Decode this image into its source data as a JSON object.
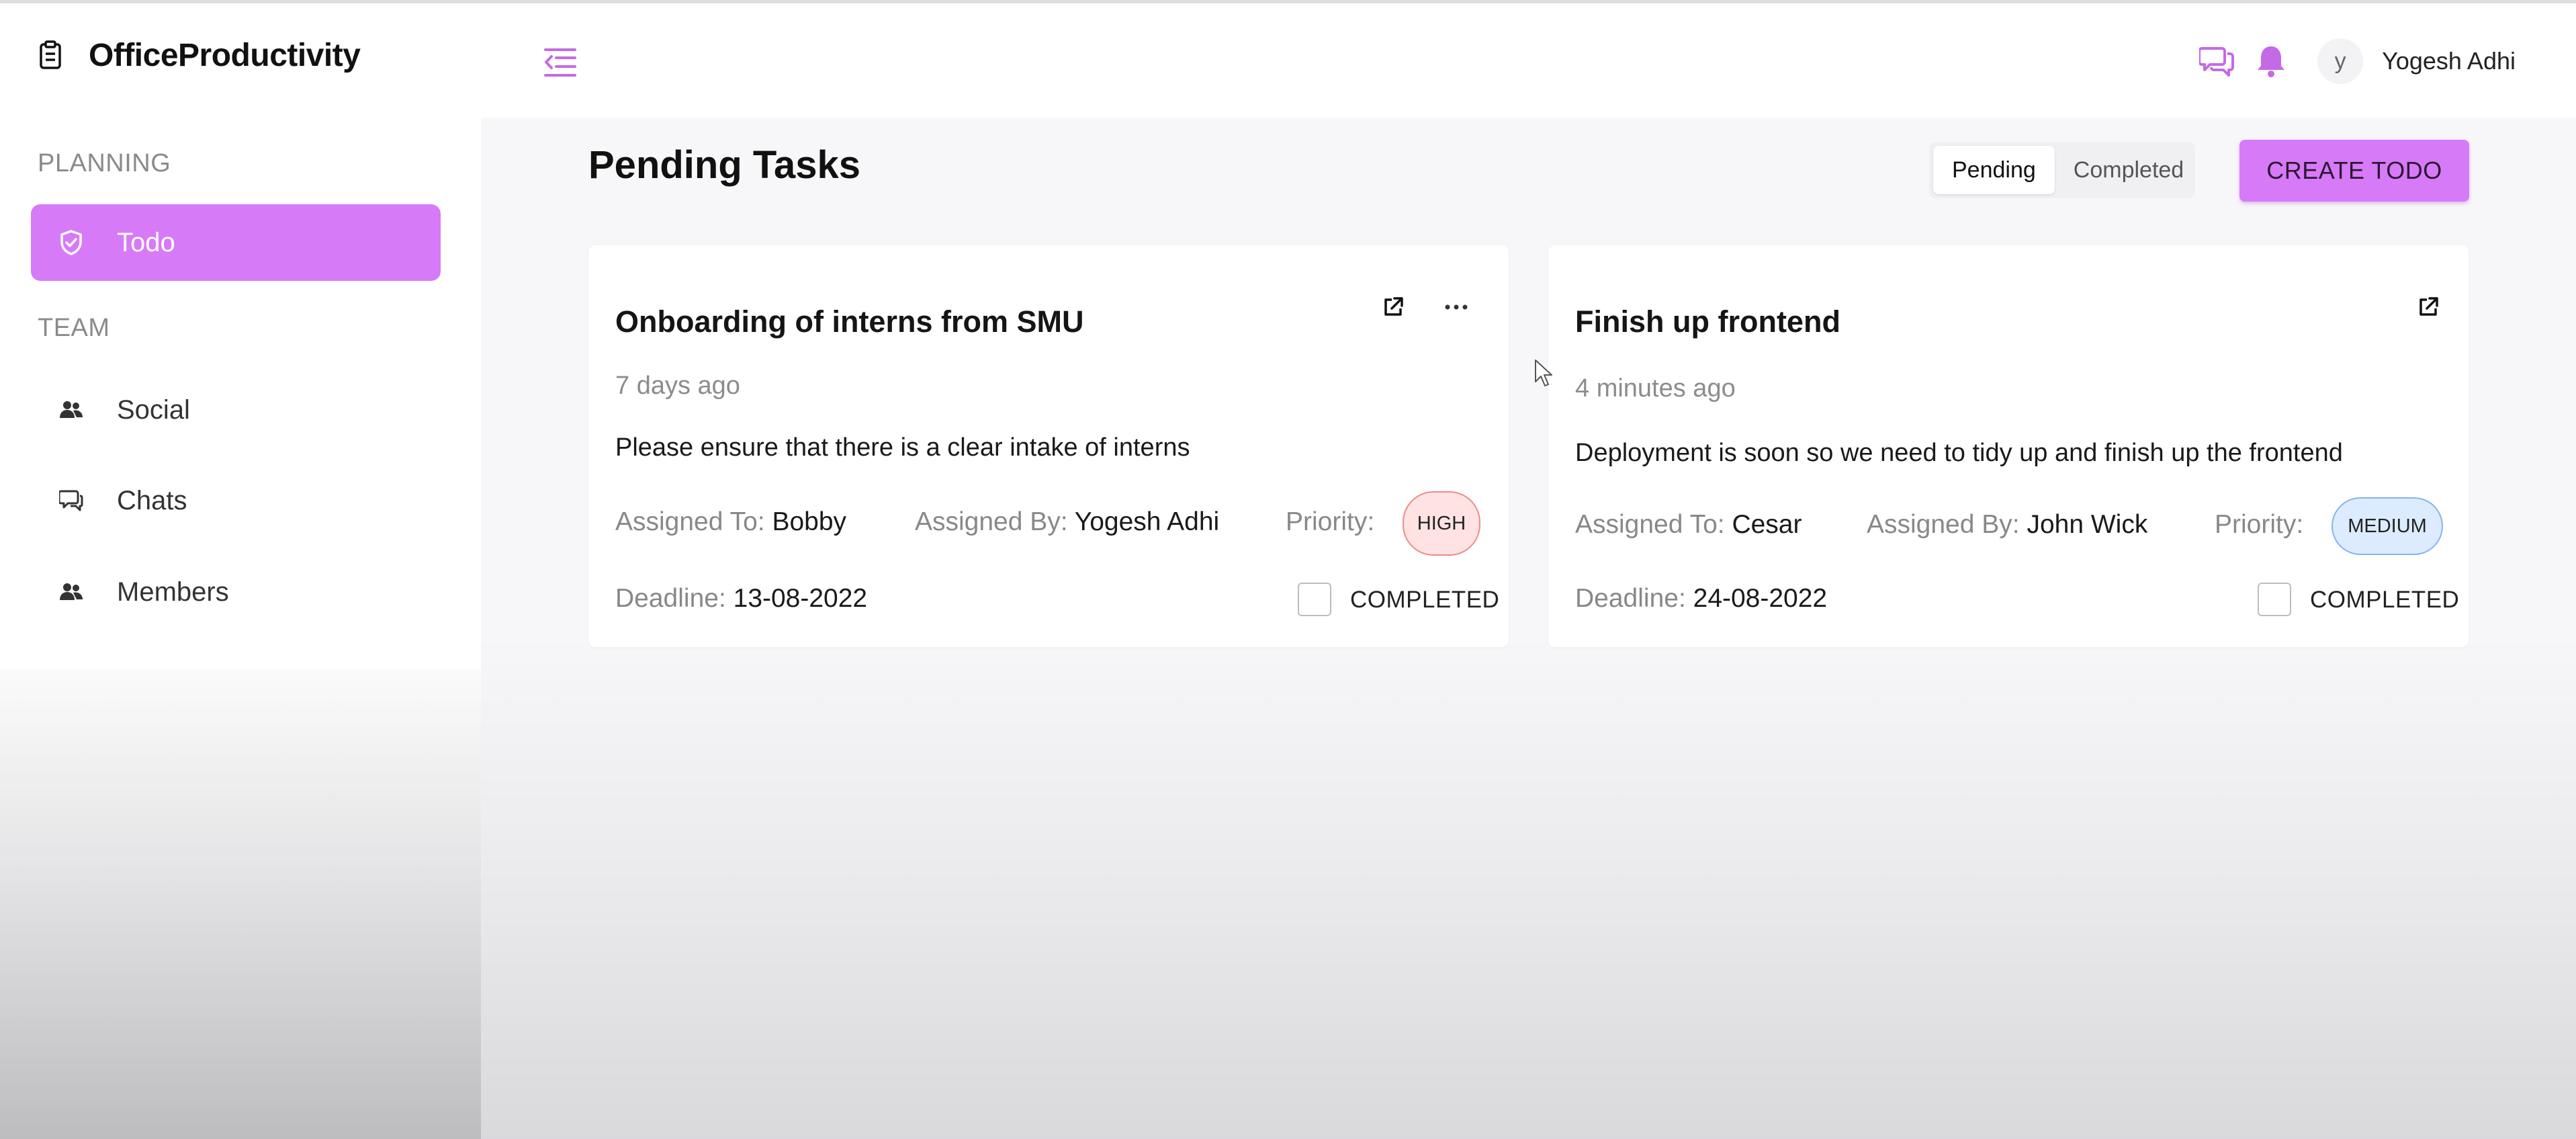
{
  "app": {
    "brand": "OfficeProductivity",
    "brand_icon": "clipboard-icon",
    "menu_icon": "menu-collapse-icon"
  },
  "header": {
    "chat_icon": "chat-bubbles-icon",
    "notification_icon": "bell-icon",
    "avatar_initial": "y",
    "user_name": "Yogesh Adhi"
  },
  "sidebar": {
    "sections": [
      {
        "label": "PLANNING",
        "items": [
          {
            "label": "Todo",
            "icon": "shield-check-icon",
            "active": true
          }
        ]
      },
      {
        "label": "TEAM",
        "items": [
          {
            "label": "Social",
            "icon": "users-icon",
            "active": false
          },
          {
            "label": "Chats",
            "icon": "chat-icon",
            "active": false
          },
          {
            "label": "Members",
            "icon": "users-icon",
            "active": false
          }
        ]
      }
    ]
  },
  "main": {
    "title": "Pending Tasks",
    "filters": [
      {
        "label": "Pending",
        "active": true
      },
      {
        "label": "Completed",
        "active": false
      }
    ],
    "create_button": "CREATE TODO",
    "cards": [
      {
        "title": "Onboarding of interns from SMU",
        "time": "7 days ago",
        "description": "Please ensure that there is a clear intake of interns",
        "assigned_to_label": "Assigned To:",
        "assigned_to": "Bobby",
        "assigned_by_label": "Assigned By:",
        "assigned_by": "Yogesh Adhi",
        "priority_label": "Priority:",
        "priority": "HIGH",
        "deadline_label": "Deadline:",
        "deadline": "13-08-2022",
        "completed_label": "COMPLETED",
        "completed": false,
        "actions": [
          "open-external-icon",
          "more-options-icon"
        ]
      },
      {
        "title": "Finish up frontend",
        "time": "4 minutes ago",
        "description": "Deployment is soon so we need to tidy up and finish up the frontend",
        "assigned_to_label": "Assigned To:",
        "assigned_to": "Cesar",
        "assigned_by_label": "Assigned By:",
        "assigned_by": "John Wick",
        "priority_label": "Priority:",
        "priority": "MEDIUM",
        "deadline_label": "Deadline:",
        "deadline": "24-08-2022",
        "completed_label": "COMPLETED",
        "completed": false,
        "actions": [
          "open-external-icon"
        ]
      }
    ]
  },
  "colors": {
    "accent": "#d77af7",
    "high_bg": "#ffe3e3",
    "high_border": "#ee8a8a",
    "medium_bg": "#dcebfd",
    "medium_border": "#86b4ef"
  }
}
